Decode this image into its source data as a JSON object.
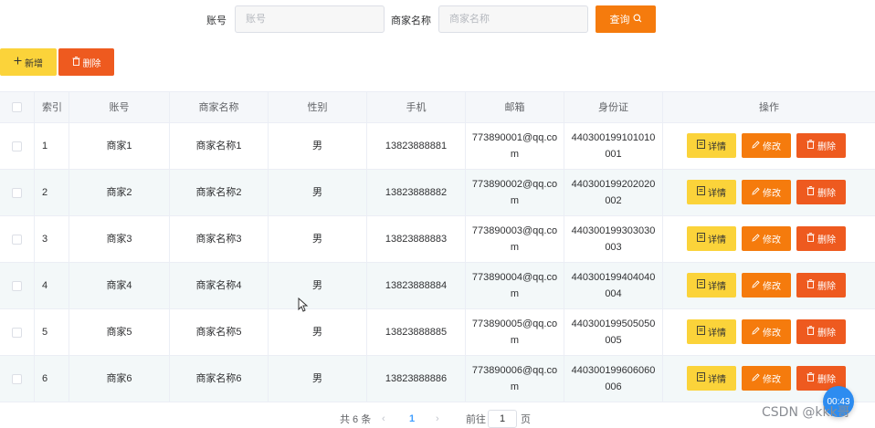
{
  "search": {
    "account_label": "账号",
    "account_placeholder": "账号",
    "merchant_label": "商家名称",
    "merchant_placeholder": "商家名称",
    "query_label": "查询",
    "query_icon": "search-icon"
  },
  "toolbar": {
    "add_label": "新增",
    "add_icon": "plus-icon",
    "delete_label": "删除",
    "delete_icon": "trash-icon"
  },
  "table": {
    "headers": [
      "索引",
      "账号",
      "商家名称",
      "性别",
      "手机",
      "邮箱",
      "身份证",
      "操作"
    ],
    "rows": [
      {
        "index": "1",
        "account": "商家1",
        "merchant_name": "商家名称1",
        "gender": "男",
        "phone": "13823888881",
        "email": "773890001@qq.com",
        "id_card": "440300199101010001"
      },
      {
        "index": "2",
        "account": "商家2",
        "merchant_name": "商家名称2",
        "gender": "男",
        "phone": "13823888882",
        "email": "773890002@qq.com",
        "id_card": "440300199202020002"
      },
      {
        "index": "3",
        "account": "商家3",
        "merchant_name": "商家名称3",
        "gender": "男",
        "phone": "13823888883",
        "email": "773890003@qq.com",
        "id_card": "440300199303030003"
      },
      {
        "index": "4",
        "account": "商家4",
        "merchant_name": "商家名称4",
        "gender": "男",
        "phone": "13823888884",
        "email": "773890004@qq.com",
        "id_card": "440300199404040004"
      },
      {
        "index": "5",
        "account": "商家5",
        "merchant_name": "商家名称5",
        "gender": "男",
        "phone": "13823888885",
        "email": "773890005@qq.com",
        "id_card": "440300199505050005"
      },
      {
        "index": "6",
        "account": "商家6",
        "merchant_name": "商家名称6",
        "gender": "男",
        "phone": "13823888886",
        "email": "773890006@qq.com",
        "id_card": "440300199606060006"
      }
    ],
    "actions": {
      "detail_label": "详情",
      "edit_label": "修改",
      "delete_label": "删除"
    }
  },
  "pagination": {
    "total_text": "共 6 条",
    "prev_symbol": "‹",
    "current_page": "1",
    "next_symbol": "›",
    "goto_prefix": "前往",
    "goto_value": "1",
    "goto_suffix": "页"
  },
  "overlay": {
    "timer": "00:43",
    "watermark": "CSDN @kkk哥"
  },
  "colors": {
    "warning": "#fbd33a",
    "orange": "#f57b0d",
    "danger": "#ee5a1f",
    "primary": "#409eff"
  }
}
